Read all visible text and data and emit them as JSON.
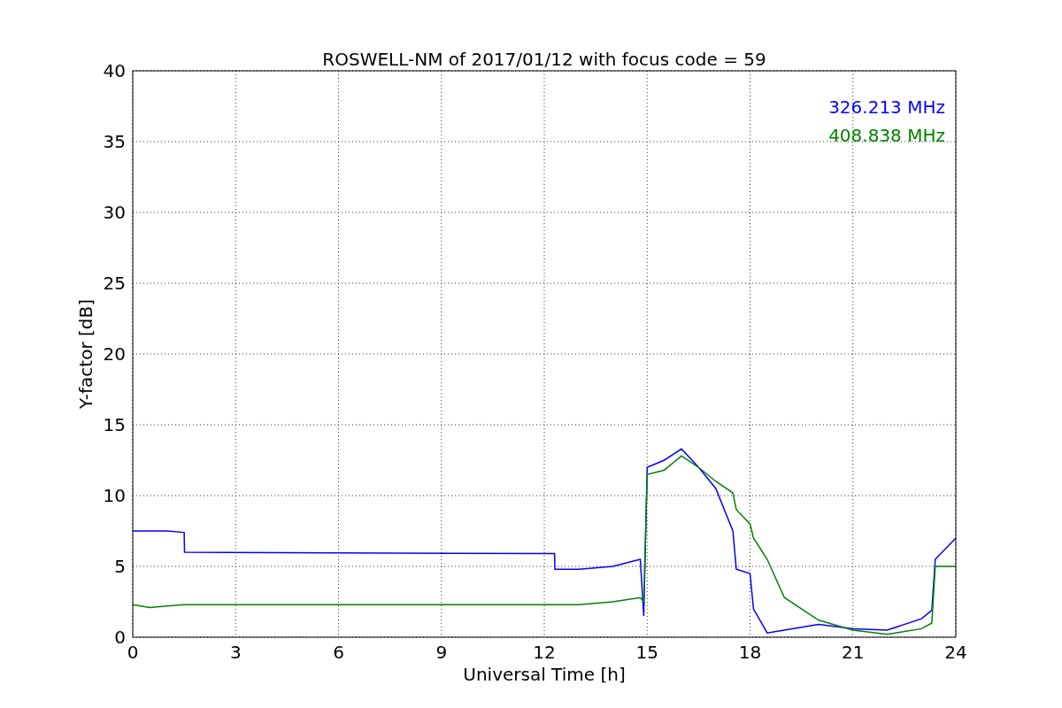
{
  "chart_data": {
    "type": "line",
    "title": "ROSWELL-NM of 2017/01/12 with focus code = 59",
    "xlabel": "Universal Time [h]",
    "ylabel": "Y-factor [dB]",
    "x": [
      0,
      0.5,
      1,
      1.5,
      1.51,
      12.3,
      12.31,
      13,
      14,
      14.8,
      14.9,
      15,
      15.5,
      16,
      16.5,
      17,
      17.5,
      17.6,
      18,
      18.1,
      18.5,
      19,
      20,
      21,
      22,
      23,
      23.3,
      23.4,
      24
    ],
    "series": [
      {
        "name": "326.213 MHz",
        "color": "#0000ff",
        "values": [
          7.5,
          7.5,
          7.5,
          7.4,
          6.0,
          5.9,
          4.8,
          4.8,
          5.0,
          5.5,
          1.5,
          12,
          12.5,
          13.3,
          12,
          10.5,
          7.5,
          4.8,
          4.5,
          2,
          0.3,
          0.5,
          0.9,
          0.6,
          0.5,
          1.3,
          1.9,
          5.5,
          7
        ]
      },
      {
        "name": "408.838 MHz",
        "color": "#008000",
        "values": [
          2.3,
          2.1,
          2.2,
          2.3,
          2.3,
          2.3,
          2.3,
          2.3,
          2.5,
          2.8,
          2.5,
          11.5,
          11.8,
          12.8,
          12,
          11,
          10.2,
          9,
          8,
          7,
          5.5,
          2.8,
          1.2,
          0.5,
          0.2,
          0.6,
          1.0,
          5,
          5
        ]
      }
    ],
    "grid": true,
    "xlim": [
      0,
      24
    ],
    "ylim": [
      0,
      40
    ],
    "xticks": [
      0,
      3,
      6,
      9,
      12,
      15,
      18,
      21,
      24
    ],
    "yticks": [
      0,
      5,
      10,
      15,
      20,
      25,
      30,
      35,
      40
    ]
  }
}
